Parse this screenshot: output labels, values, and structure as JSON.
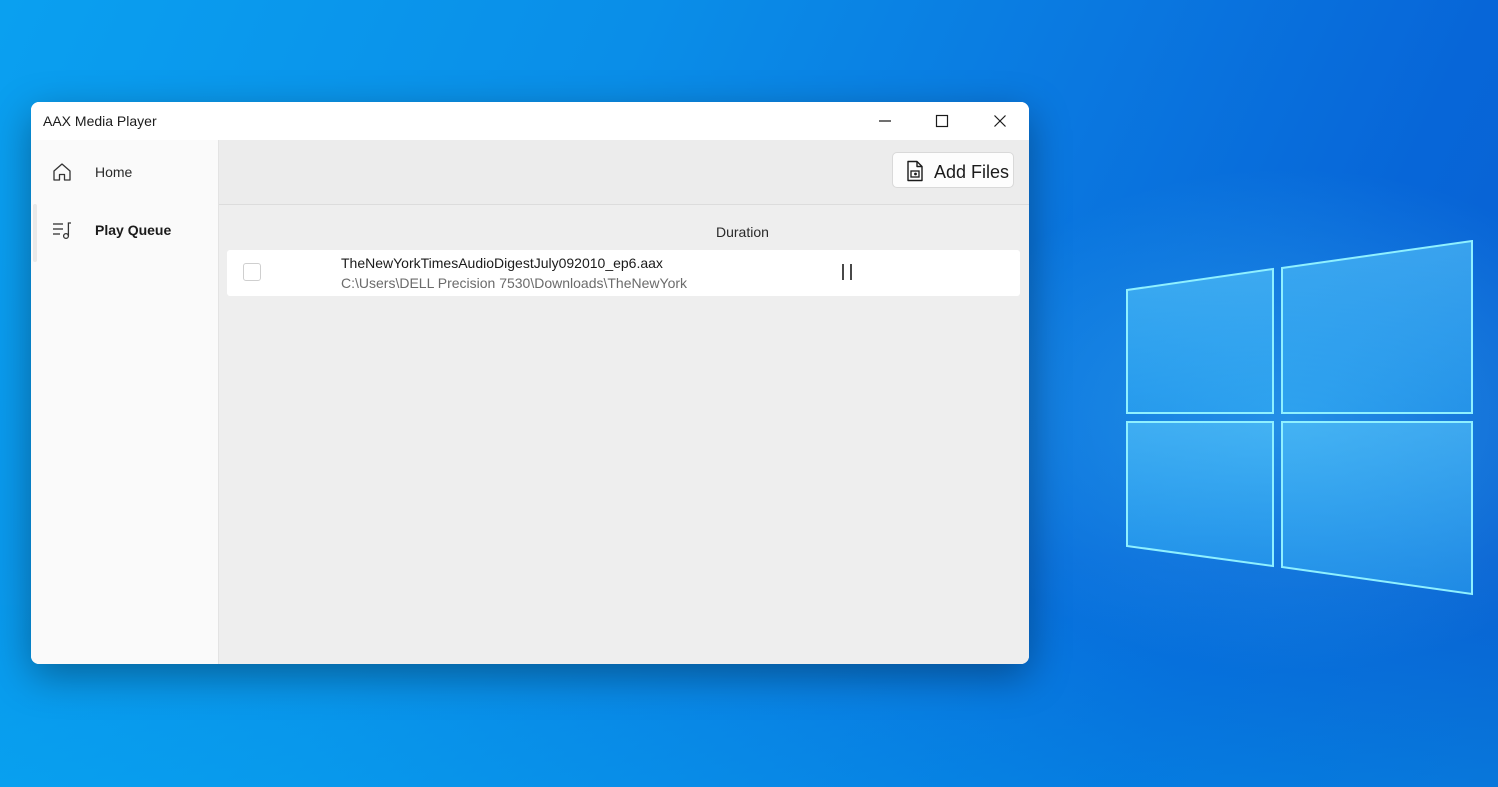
{
  "window": {
    "title": "AAX Media Player",
    "controls": {
      "minimize_icon": "minimize-icon",
      "maximize_icon": "maximize-icon",
      "close_icon": "close-icon"
    }
  },
  "sidebar": {
    "items": [
      {
        "label": "Home",
        "icon": "home-icon",
        "active": false
      },
      {
        "label": "Play Queue",
        "icon": "music-queue-icon",
        "active": true
      }
    ]
  },
  "toolbar": {
    "add_files_label": "Add Files",
    "add_files_icon": "audio-file-icon"
  },
  "queue": {
    "columns": [
      "Duration"
    ],
    "rows": [
      {
        "checked": false,
        "file_name": "TheNewYorkTimesAudioDigestJuly092010_ep6.aax",
        "path": "C:\\Users\\DELL Precision 7530\\Downloads\\TheNewYork",
        "status_icon": "pause-icon"
      }
    ]
  },
  "colors": {
    "desktop_blue": "#0a8ee8",
    "window_bg": "#f3f3f3",
    "sidebar_bg": "#fafafa",
    "content_bg": "#eeeeee"
  }
}
